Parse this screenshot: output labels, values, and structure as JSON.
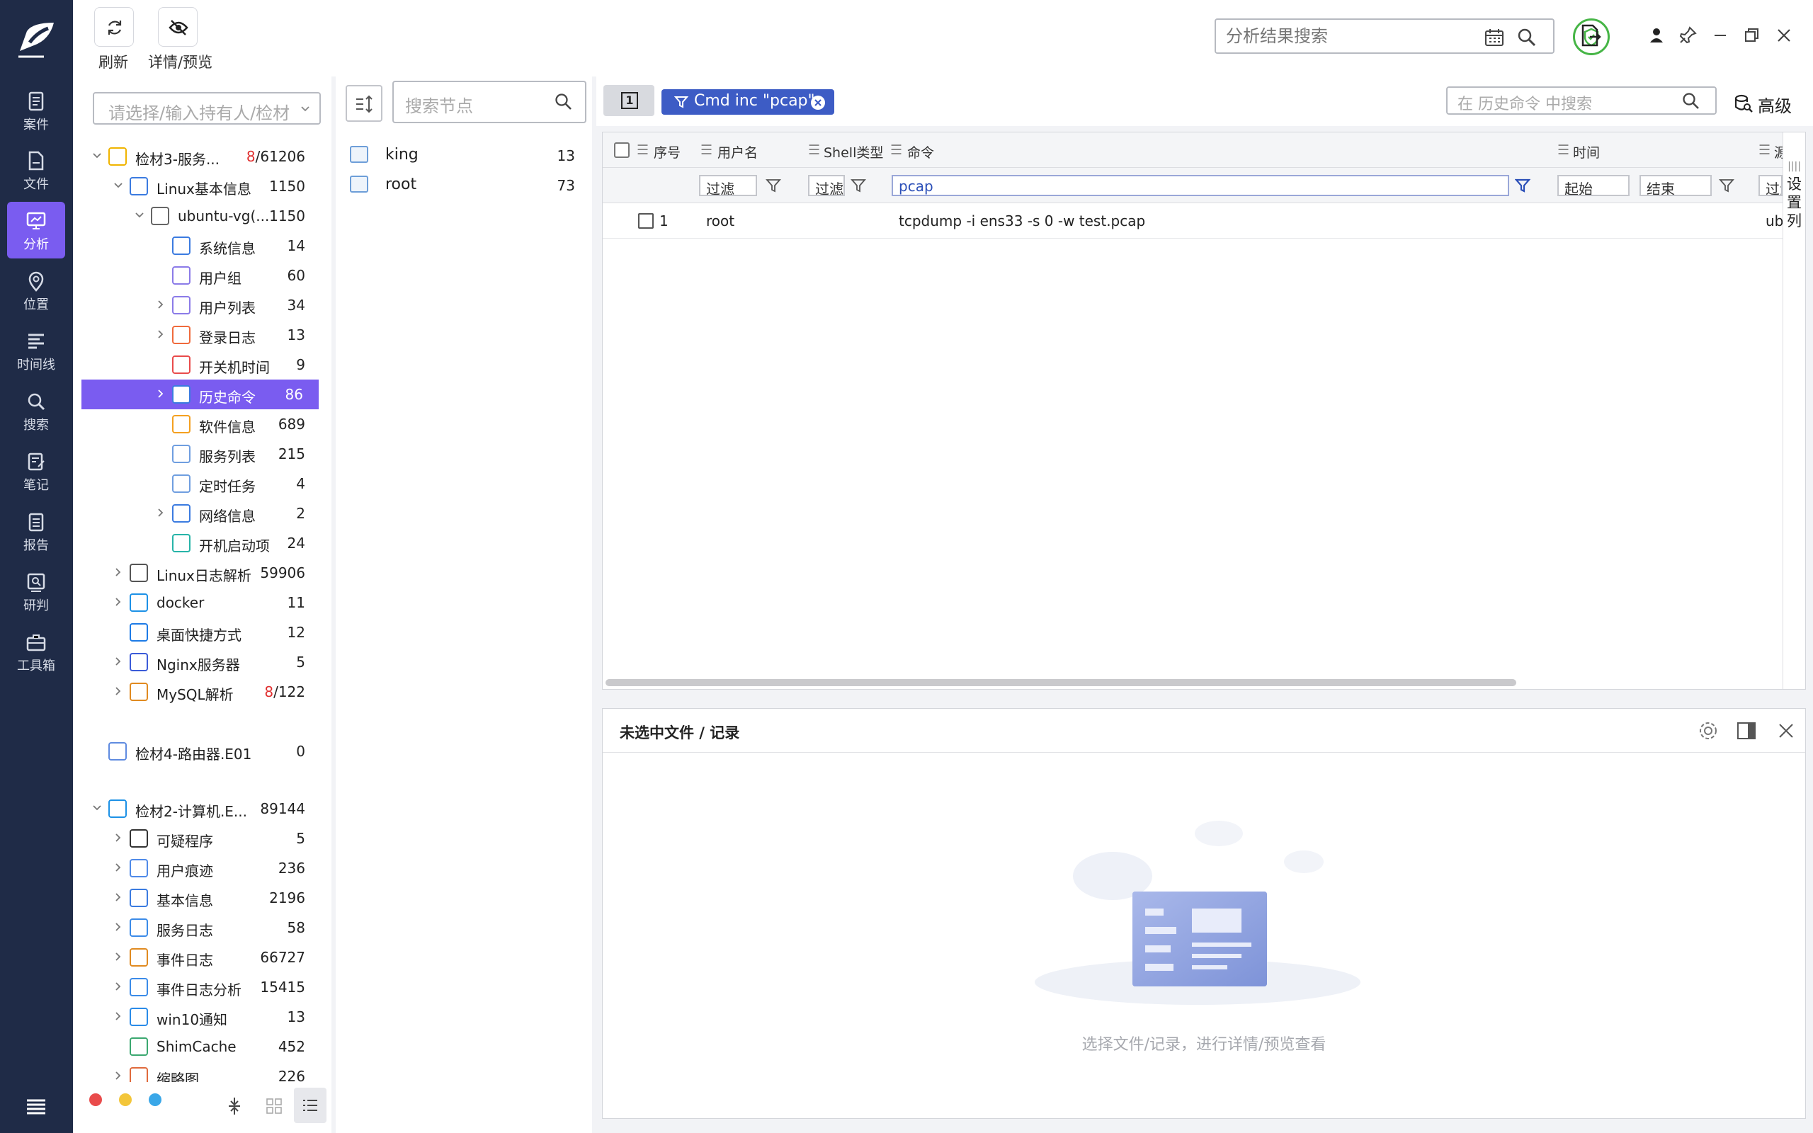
{
  "toolbar": {
    "refresh_label": "刷新",
    "detail_preview_label": "详情/预览",
    "search_placeholder": "分析结果搜索"
  },
  "nav": [
    {
      "label": "案件",
      "icon": "case-icon"
    },
    {
      "label": "文件",
      "icon": "file-icon"
    },
    {
      "label": "分析",
      "icon": "analysis-icon",
      "active": true
    },
    {
      "label": "位置",
      "icon": "location-icon"
    },
    {
      "label": "时间线",
      "icon": "timeline-icon"
    },
    {
      "label": "搜索",
      "icon": "search-icon"
    },
    {
      "label": "笔记",
      "icon": "note-icon"
    },
    {
      "label": "报告",
      "icon": "report-icon"
    },
    {
      "label": "研判",
      "icon": "judge-icon"
    },
    {
      "label": "工具箱",
      "icon": "toolbox-icon"
    }
  ],
  "tree": {
    "holder_placeholder": "请选择/输入持有人/检材",
    "rows": [
      {
        "label": "检材3-服务...",
        "count_red": "8",
        "count": "/61206"
      },
      {
        "label": "Linux基本信息",
        "count": "1150"
      },
      {
        "label": "ubuntu-vg(...",
        "count": "1150"
      },
      {
        "label": "系统信息",
        "count": "14"
      },
      {
        "label": "用户组",
        "count": "60"
      },
      {
        "label": "用户列表",
        "count": "34"
      },
      {
        "label": "登录日志",
        "count": "13"
      },
      {
        "label": "开关机时间",
        "count": "9"
      },
      {
        "label": "历史命令",
        "count": "86"
      },
      {
        "label": "软件信息",
        "count": "689"
      },
      {
        "label": "服务列表",
        "count": "215"
      },
      {
        "label": "定时任务",
        "count": "4"
      },
      {
        "label": "网络信息",
        "count": "2"
      },
      {
        "label": "开机启动项",
        "count": "24"
      },
      {
        "label": "Linux日志解析",
        "count": "59906"
      },
      {
        "label": "docker",
        "count": "11"
      },
      {
        "label": "桌面快捷方式",
        "count": "12"
      },
      {
        "label": "Nginx服务器",
        "count": "5"
      },
      {
        "label": "MySQL解析",
        "count_red": "8",
        "count": "/122"
      },
      {
        "label": "检材4-路由器.E01",
        "count": "0"
      },
      {
        "label": "检材2-计算机.E...",
        "count": "89144"
      },
      {
        "label": "可疑程序",
        "count": "5"
      },
      {
        "label": "用户痕迹",
        "count": "236"
      },
      {
        "label": "基本信息",
        "count": "2196"
      },
      {
        "label": "服务日志",
        "count": "58"
      },
      {
        "label": "事件日志",
        "count": "66727"
      },
      {
        "label": "事件日志分析",
        "count": "15415"
      },
      {
        "label": "win10通知",
        "count": "13"
      },
      {
        "label": "ShimCache",
        "count": "452"
      },
      {
        "label": "缩略图",
        "count": "226"
      }
    ]
  },
  "nodes": {
    "search_placeholder": "搜索节点",
    "items": [
      {
        "label": "king",
        "count": "13"
      },
      {
        "label": "root",
        "count": "73"
      }
    ]
  },
  "filter_chip": "Cmd inc \"pcap\"",
  "tab_number": "1",
  "history_search_placeholder": "在 历史命令 中搜索",
  "advanced_label": "高级",
  "table": {
    "headers": {
      "seq": "序号",
      "user": "用户名",
      "shell": "Shell类型",
      "cmd": "命令",
      "time": "时间",
      "extra": "源"
    },
    "filters": {
      "user": "过滤",
      "shell": "过滤",
      "cmd": "pcap",
      "start": "起始",
      "end": "结束",
      "extra": "过滤"
    },
    "rows": [
      {
        "seq": "1",
        "user": "root",
        "cmd": "tcpdump -i ens33 -s 0 -w test.pcap",
        "extra": "ub"
      }
    ],
    "set_columns": "设置列"
  },
  "detail": {
    "title": "未选中文件 / 记录",
    "empty_text": "选择文件/记录，进行详情/预览查看"
  },
  "colors": {
    "nav_bg": "#1f2b47",
    "accent": "#7a5cf0",
    "chip": "#3d5cc5",
    "dot_red": "#e94b4b",
    "dot_yellow": "#f3c63a",
    "dot_blue": "#3aa7e8"
  }
}
